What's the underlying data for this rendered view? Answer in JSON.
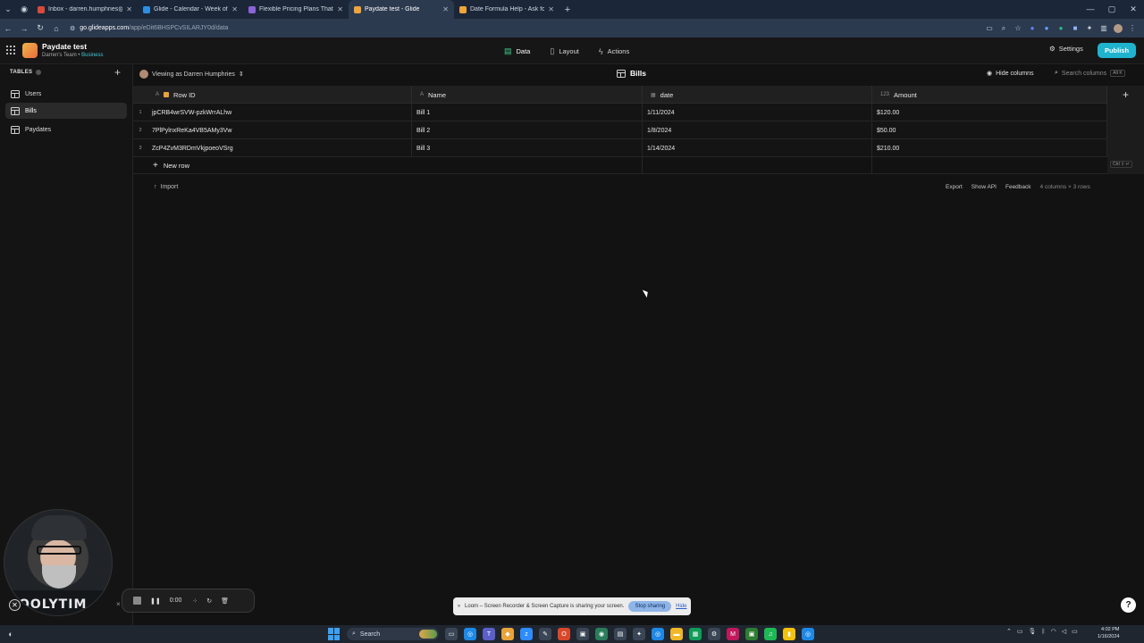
{
  "browser": {
    "tabs": [
      {
        "title": "Inbox - darren.humphries@hey",
        "color": "#d84a3c",
        "active": false
      },
      {
        "title": "Glide - Calendar - Week of Jan",
        "color": "#2f8ee0",
        "active": false
      },
      {
        "title": "Flexible Pricing Plans That Scale",
        "color": "#8c63d8",
        "active": false
      },
      {
        "title": "Paydate test - Glide",
        "color": "#f0a43a",
        "active": true
      },
      {
        "title": "Date Formula Help - Ask for He",
        "color": "#f0a43a",
        "active": false
      }
    ],
    "url_host": "go.glideapps.com",
    "url_path": "/app/eDit6BHSPCvSILARJY0d/data"
  },
  "app": {
    "name": "Paydate test",
    "team": "Darren's Team",
    "plan": "Business",
    "nav": {
      "data": "Data",
      "layout": "Layout",
      "actions": "Actions"
    },
    "settings": "Settings",
    "publish": "Publish"
  },
  "sidebar": {
    "heading": "TABLES",
    "items": [
      {
        "label": "Users",
        "active": false
      },
      {
        "label": "Bills",
        "active": true
      },
      {
        "label": "Paydates",
        "active": false
      }
    ]
  },
  "toolbar": {
    "viewing_as": "Viewing as Darren Humphries",
    "table_title": "Bills",
    "hide_columns": "Hide columns",
    "search_placeholder": "Search columns",
    "search_shortcut": "Alt K"
  },
  "table": {
    "columns": [
      {
        "name": "Row ID",
        "type": "A"
      },
      {
        "name": "Name",
        "type": "A"
      },
      {
        "name": "date",
        "type": "cal"
      },
      {
        "name": "Amount",
        "type": "123"
      }
    ],
    "rows": [
      {
        "num": "1",
        "row_id": "jpCRB4wrSVW-pzkWrrALhw",
        "name": "Bill 1",
        "date": "1/11/2024",
        "amount": "$120.00"
      },
      {
        "num": "2",
        "row_id": "7PlPylnxReKa4VB5AMy3Vw",
        "name": "Bill 2",
        "date": "1/8/2024",
        "amount": "$50.00"
      },
      {
        "num": "3",
        "row_id": "ZcP4ZvM3RDmVkjpoeoVSrg",
        "name": "Bill 3",
        "date": "1/14/2024",
        "amount": "$210.00"
      }
    ],
    "new_row": "New row",
    "new_row_shortcut": "Ctrl ⇧ ↵"
  },
  "footer": {
    "import": "Import",
    "export": "Export",
    "show_api": "Show API",
    "feedback": "Feedback",
    "meta": "4 columns × 3 rows"
  },
  "loom": {
    "time": "0:00",
    "hoodie_text": "OOLYTIM",
    "share_text": "Loom – Screen Recorder & Screen Capture is sharing your screen.",
    "stop_sharing": "Stop sharing",
    "hide": "Hide"
  },
  "taskbar": {
    "search": "Search",
    "time": "4:02 PM",
    "date": "1/16/2024"
  }
}
